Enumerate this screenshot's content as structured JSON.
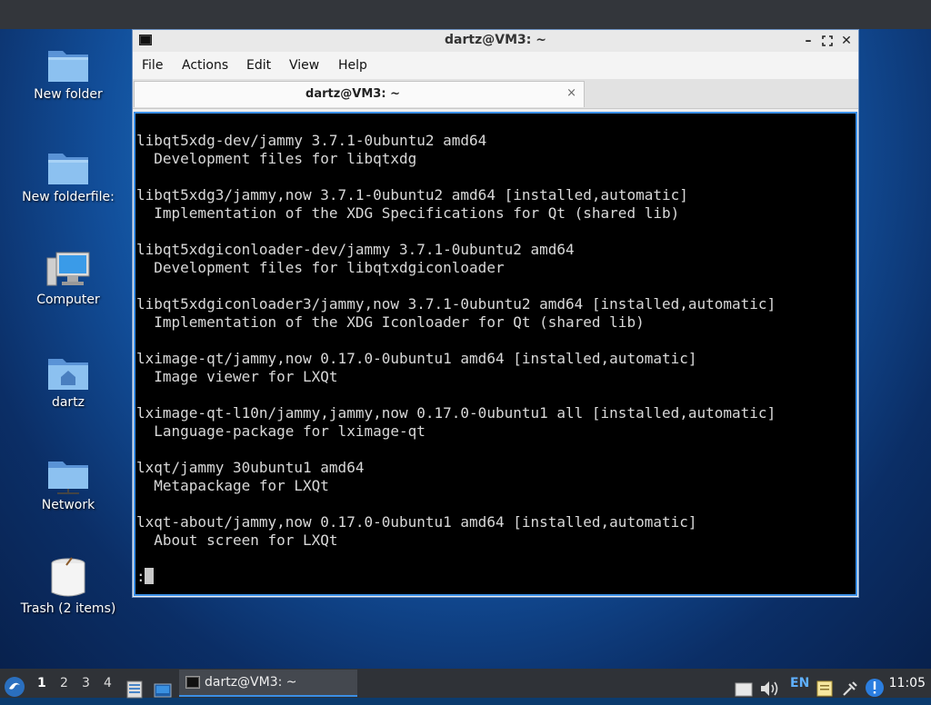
{
  "desktop": {
    "icons": [
      {
        "label": "New folder",
        "icon": "folder-icon"
      },
      {
        "label": "New folderfile:",
        "icon": "folder-icon"
      },
      {
        "label": "Computer",
        "icon": "computer-icon"
      },
      {
        "label": "dartz",
        "icon": "home-folder-icon"
      },
      {
        "label": "Network",
        "icon": "network-folder-icon"
      },
      {
        "label": "Trash (2 items)",
        "icon": "trash-icon"
      }
    ]
  },
  "window": {
    "title": "dartz@VM3: ~",
    "menu": [
      "File",
      "Actions",
      "Edit",
      "View",
      "Help"
    ],
    "tab": {
      "label": "dartz@VM3: ~",
      "close": "×"
    }
  },
  "terminal": {
    "lines": [
      "libqt5xdg-dev/jammy 3.7.1-0ubuntu2 amd64",
      "  Development files for libqtxdg",
      "",
      "libqt5xdg3/jammy,now 3.7.1-0ubuntu2 amd64 [installed,automatic]",
      "  Implementation of the XDG Specifications for Qt (shared lib)",
      "",
      "libqt5xdgiconloader-dev/jammy 3.7.1-0ubuntu2 amd64",
      "  Development files for libqtxdgiconloader",
      "",
      "libqt5xdgiconloader3/jammy,now 3.7.1-0ubuntu2 amd64 [installed,automatic]",
      "  Implementation of the XDG Iconloader for Qt (shared lib)",
      "",
      "lximage-qt/jammy,now 0.17.0-0ubuntu1 amd64 [installed,automatic]",
      "  Image viewer for LXQt",
      "",
      "lximage-qt-l10n/jammy,jammy,now 0.17.0-0ubuntu1 all [installed,automatic]",
      "  Language-package for lximage-qt",
      "",
      "lxqt/jammy 30ubuntu1 amd64",
      "  Metapackage for LXQt",
      "",
      "lxqt-about/jammy,now 0.17.0-0ubuntu1 amd64 [installed,automatic]",
      "  About screen for LXQt",
      "",
      ":"
    ]
  },
  "taskbar": {
    "workspaces": [
      "1",
      "2",
      "3",
      "4"
    ],
    "active_workspace": "1",
    "task_label": "dartz@VM3: ~",
    "lang": "EN",
    "clock": "11:05"
  }
}
